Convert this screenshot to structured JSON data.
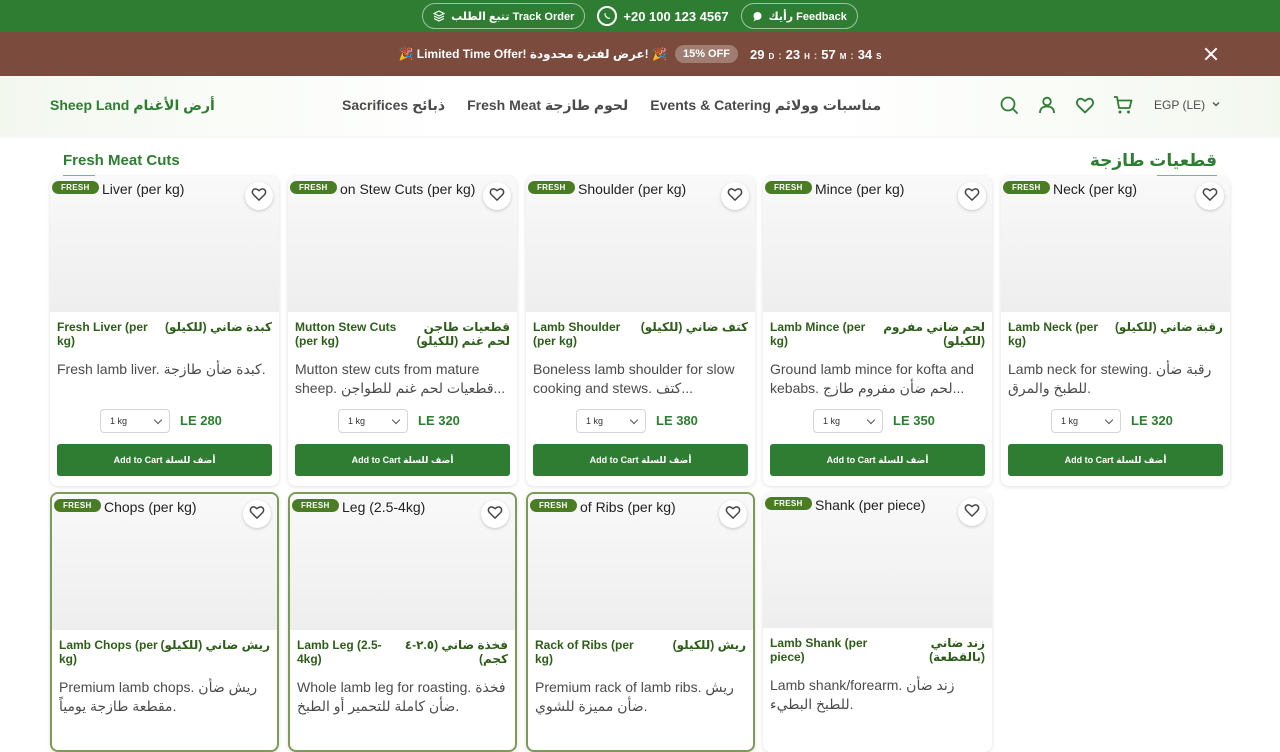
{
  "topbar": {
    "feedback": "رأيك  Feedback",
    "phone": "+20 100 123 4567",
    "track": "تتبع الطلب  Track Order"
  },
  "promo": {
    "text": "🎉 Limited Time Offer!  عرض لفترة محدودة! 🎉",
    "badge": "15% OFF",
    "days": "29",
    "hours": "23",
    "minutes": "57",
    "seconds": "34",
    "d": "D",
    "h": "H",
    "m": "M",
    "s": "S"
  },
  "header": {
    "logo": "Sheep Land  أرض الأغنام",
    "nav": [
      "Sacrifices  ذبائح",
      "Fresh Meat  لحوم طازجة",
      "Events & Catering  مناسبات وولائم"
    ],
    "currency": "EGP (LE)"
  },
  "section": {
    "title_en": "Fresh Meat Cuts",
    "title_ar": "قطعيات طازجة"
  },
  "common": {
    "fresh": "FRESH",
    "weight": "1 kg",
    "add": "Add to Cart  أضف للسلة"
  },
  "colors": {
    "primary": "#2e7d32",
    "promo": "#7b4b3e",
    "highlight_border": "#7d9b57"
  },
  "products": [
    {
      "alt": "Liver (per kg)",
      "name_en": "Fresh Liver (per kg)",
      "name_ar": "كبدة ضاني (للكيلو)",
      "desc": "Fresh lamb liver. كبدة ضأن طازجة.",
      "price": "LE 280"
    },
    {
      "alt": "on Stew Cuts (per kg)",
      "name_en": "Mutton Stew Cuts (per kg)",
      "name_ar": "قطعيات طاجن لحم غنم (للكيلو)",
      "desc": "Mutton stew cuts from mature sheep. قطعيات لحم غنم للطواجن...",
      "price": "LE 320"
    },
    {
      "alt": "Shoulder (per kg)",
      "name_en": "Lamb Shoulder (per kg)",
      "name_ar": "كتف ضاني (للكيلو)",
      "desc": "Boneless lamb shoulder for slow cooking and stews. كتف...",
      "price": "LE 380"
    },
    {
      "alt": "Mince (per kg)",
      "name_en": "Lamb Mince (per kg)",
      "name_ar": "لحم ضاني مفروم (للكيلو)",
      "desc": "Ground lamb mince for kofta and kebabs. لحم ضأن مفروم طازج...",
      "price": "LE 350"
    },
    {
      "alt": "Neck (per kg)",
      "name_en": "Lamb Neck (per kg)",
      "name_ar": "رقبة ضاني (للكيلو)",
      "desc": "Lamb neck for stewing. رقبة ضأن للطبخ والمرق.",
      "price": "LE 320"
    },
    {
      "alt": "Chops (per kg)",
      "name_en": "Lamb Chops (per kg)",
      "name_ar": "ريش ضاني (للكيلو)",
      "desc": "Premium lamb chops. ريش ضأن مقطعة طازجة يومياً.",
      "price": ""
    },
    {
      "alt": "Leg (2.5-4kg)",
      "name_en": "Lamb Leg (2.5-4kg)",
      "name_ar": "فخذة ضاني (٢.٥-٤ كجم)",
      "desc": "Whole lamb leg for roasting. فخذة ضأن كاملة للتحمير أو الطبخ.",
      "price": ""
    },
    {
      "alt": "of Ribs (per kg)",
      "name_en": "Rack of Ribs (per kg)",
      "name_ar": "ريش (للكيلو)",
      "desc": "Premium rack of lamb ribs. ريش ضأن مميزة للشوي.",
      "price": ""
    },
    {
      "alt": "Shank (per piece)",
      "name_en": "Lamb Shank (per piece)",
      "name_ar": "زند ضاني (بالقطعة)",
      "desc": "Lamb shank/forearm. زند ضأن للطبخ البطيء.",
      "price": ""
    }
  ]
}
